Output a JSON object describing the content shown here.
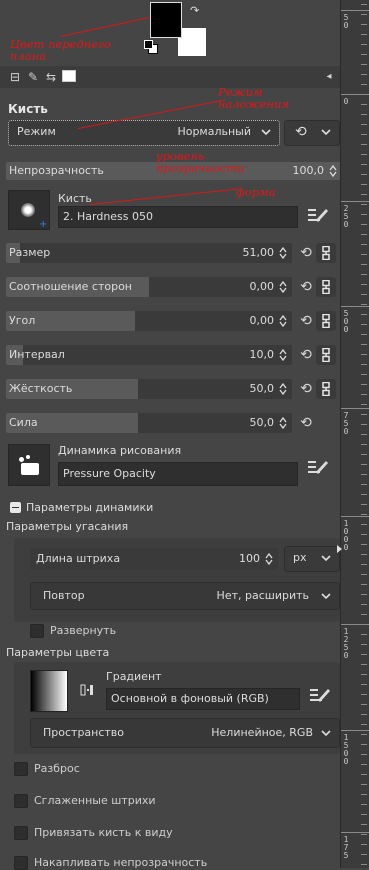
{
  "annotations": {
    "fg_color": "Цвет переднего плана",
    "blend_mode": "Режим наложения",
    "opacity_level": "уровень прозрачности",
    "shape": "форма"
  },
  "panel": {
    "title": "Кисть"
  },
  "mode": {
    "label": "Режим",
    "value": "Нормальный"
  },
  "opacity": {
    "label": "Непрозрачность",
    "value": "100,0",
    "level": 1.0
  },
  "brush": {
    "label": "Кисть",
    "name": "2. Hardness 050"
  },
  "sliders": [
    {
      "label": "Размер",
      "value": "51,00",
      "level": 0.05,
      "chain": true
    },
    {
      "label": "Соотношение сторон",
      "value": "0,00",
      "level": 0.5,
      "chain": true
    },
    {
      "label": "Угол",
      "value": "0,00",
      "level": 0.45,
      "chain": true
    },
    {
      "label": "Интервал",
      "value": "10,0",
      "level": 0.06,
      "chain": true
    },
    {
      "label": "Жёсткость",
      "value": "50,0",
      "level": 0.46,
      "chain": true
    },
    {
      "label": "Сила",
      "value": "50,0",
      "level": 0.46,
      "chain": false
    }
  ],
  "dynamics": {
    "label": "Динамика рисования",
    "name": "Pressure Opacity"
  },
  "dynamics_options": {
    "header": "Параметры динамики",
    "fade_header": "Параметры угасания",
    "stroke_length": {
      "label": "Длина штриха",
      "value": "100",
      "unit": "px"
    },
    "repeat": {
      "label": "Повтор",
      "value": "Нет, расширить"
    },
    "reverse": {
      "label": "Развернуть",
      "checked": false
    },
    "color_header": "Параметры цвета",
    "gradient": {
      "label": "Градиент",
      "name": "Основной в фоновый (RGB)"
    },
    "space": {
      "label": "Пространство",
      "value": "Нелинейное, RGB"
    }
  },
  "options": [
    {
      "label": "Разброс",
      "checked": false
    },
    {
      "label": "Сглаженные штрихи",
      "checked": false
    },
    {
      "label": "Привязать кисть к виду",
      "checked": false
    },
    {
      "label": "Накапливать непрозрачность",
      "checked": false
    }
  ],
  "ruler": {
    "labels": [
      {
        "text": "5\n0"
      },
      {
        "text": "0"
      },
      {
        "text": "2\n5\n0"
      },
      {
        "text": "5\n0\n0"
      },
      {
        "text": "7\n5\n0"
      },
      {
        "text": "1\n0\n0\n0"
      },
      {
        "text": "1\n2\n5\n0"
      },
      {
        "text": "1\n5\n0\n0"
      },
      {
        "text": "1\n7\n5"
      }
    ]
  },
  "colors": {
    "foreground": "#000000",
    "background": "#ffffff",
    "annotation": "#e01818"
  }
}
